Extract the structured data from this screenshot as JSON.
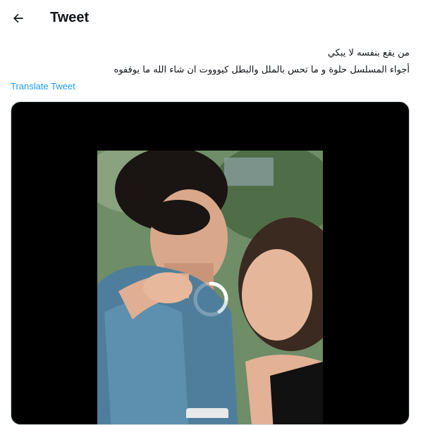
{
  "header": {
    "title": "Tweet",
    "back_icon": "arrow-left-icon"
  },
  "tweet": {
    "lines": [
      "من يقع بنفسه لا يبكي",
      "أجواء المسلسل حلوة و ما تحس بالملل والبطل كيوووت ان شاء الله ما يوقفوه"
    ],
    "translate_label": "Translate Tweet"
  },
  "media": {
    "loading_icon": "loading-spinner-icon"
  },
  "colors": {
    "accent": "#1d9bf0",
    "text": "#0f1419",
    "media_background": "#000000"
  }
}
